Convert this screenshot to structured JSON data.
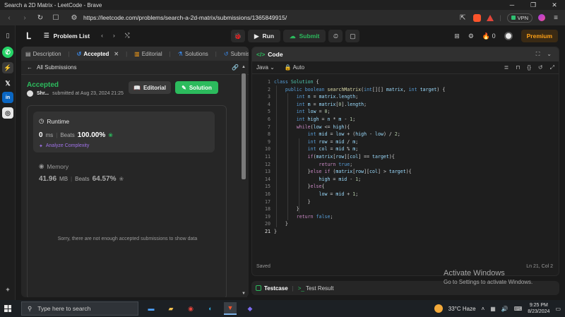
{
  "window": {
    "title": "Search a 2D Matrix - LeetCode - Brave"
  },
  "browser": {
    "url": "https://leetcode.com/problems/search-a-2d-matrix/submissions/1365849915/",
    "vpn_label": "VPN"
  },
  "nav": {
    "problem_list": "Problem List",
    "run": "Run",
    "submit": "Submit",
    "counter": "0",
    "premium": "Premium"
  },
  "tabs": [
    {
      "label": "Description",
      "active": false
    },
    {
      "label": "Accepted",
      "active": true
    },
    {
      "label": "Editorial",
      "active": false
    },
    {
      "label": "Solutions",
      "active": false
    },
    {
      "label": "Submissi",
      "active": false
    }
  ],
  "submission": {
    "back_label": "All Submissions",
    "status": "Accepted",
    "user": "Shr...",
    "submitted_at": "submitted at Aug 23, 2024 21:25",
    "editorial_btn": "Editorial",
    "solution_btn": "Solution",
    "runtime_title": "Runtime",
    "runtime_value": "0",
    "runtime_unit": "ms",
    "beats_label": "Beats",
    "runtime_beats": "100.00%",
    "analyze": "Analyze Complexity",
    "memory_title": "Memory",
    "memory_value": "41.96",
    "memory_unit": "MB",
    "memory_beats": "64.57%",
    "sorry": "Sorry, there are not enough accepted submissions to show data"
  },
  "editor": {
    "tab_label": "Code",
    "language": "Java",
    "mode": "Auto",
    "saved": "Saved",
    "cursor": "Ln 21, Col 2",
    "line_count": 21
  },
  "activation": {
    "line1": "Activate Windows",
    "line2": "Go to Settings to activate Windows."
  },
  "testbar": {
    "testcase": "Testcase",
    "test_result": "Test Result"
  },
  "taskbar": {
    "search_placeholder": "Type here to search",
    "weather": "33°C  Haze",
    "time": "9:25 PM",
    "date": "8/23/2024"
  }
}
